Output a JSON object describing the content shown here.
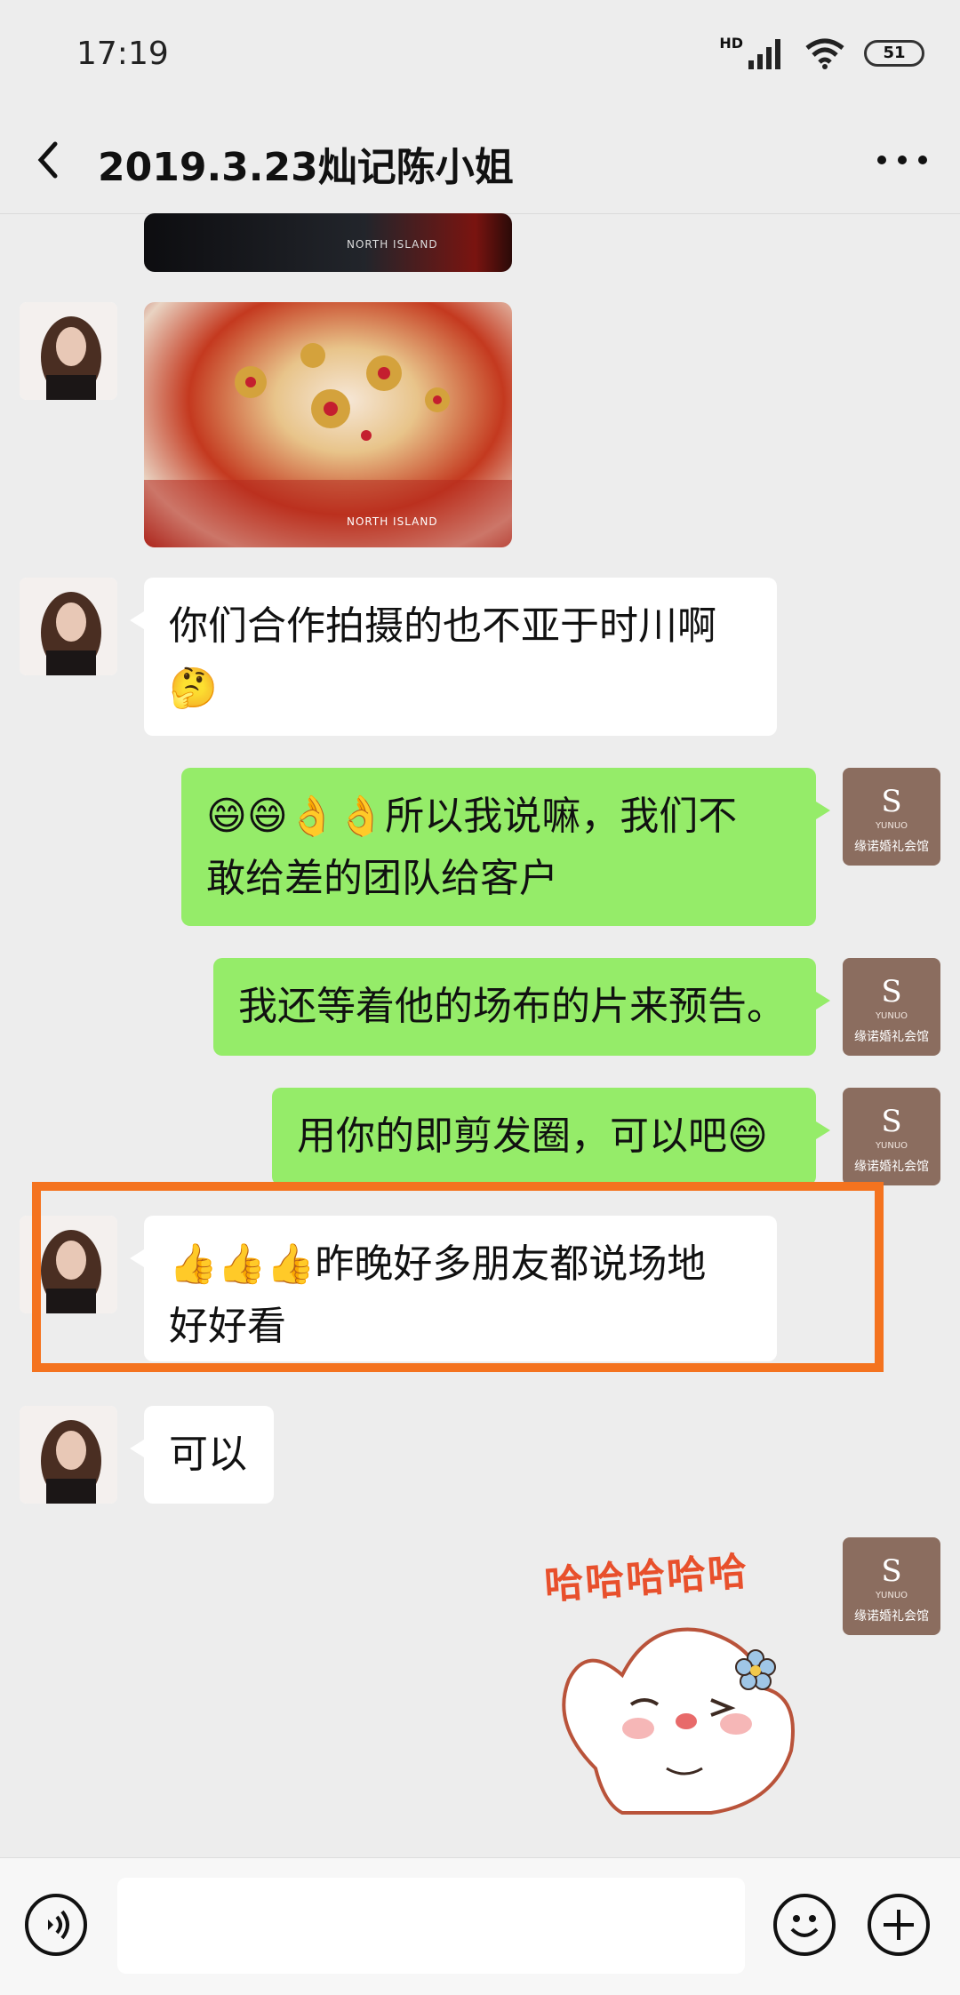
{
  "status_bar": {
    "time": "17:19",
    "network": "HD",
    "battery": "51"
  },
  "header": {
    "title": "2019.3.23灿记陈小姐"
  },
  "messages": [
    {
      "side": "left",
      "type": "image",
      "watermark": "NORTH ISLAND"
    },
    {
      "side": "left",
      "type": "text",
      "line1": "你们合作拍摄的也不亚于时川啊",
      "line2": "🤔"
    },
    {
      "side": "right",
      "type": "text",
      "line1": "😄😄👌👌所以我说嘛，我们不",
      "line2": "敢给差的团队给客户"
    },
    {
      "side": "right",
      "type": "text",
      "line1": "我还等着他的场布的片来预告。"
    },
    {
      "side": "right",
      "type": "text",
      "line1": "用你的即剪发圈，可以吧😄"
    },
    {
      "side": "left",
      "type": "text",
      "line1": "👍👍👍昨晚好多朋友都说场地",
      "line2": "好好看"
    },
    {
      "side": "left",
      "type": "text",
      "line1": "可以"
    },
    {
      "side": "right",
      "type": "sticker",
      "text": "哈哈哈哈哈"
    }
  ],
  "self_avatar": {
    "brand_top": "YUNUO",
    "brand_name": "缘诺婚礼会馆"
  },
  "bottom_bar": {
    "voice_icon": "voice-icon",
    "emoji_icon": "emoji-icon",
    "plus_icon": "plus-icon"
  },
  "colors": {
    "self_bubble": "#95ec69",
    "other_bubble": "#ffffff",
    "highlight": "#f4731f",
    "background": "#ededed"
  }
}
